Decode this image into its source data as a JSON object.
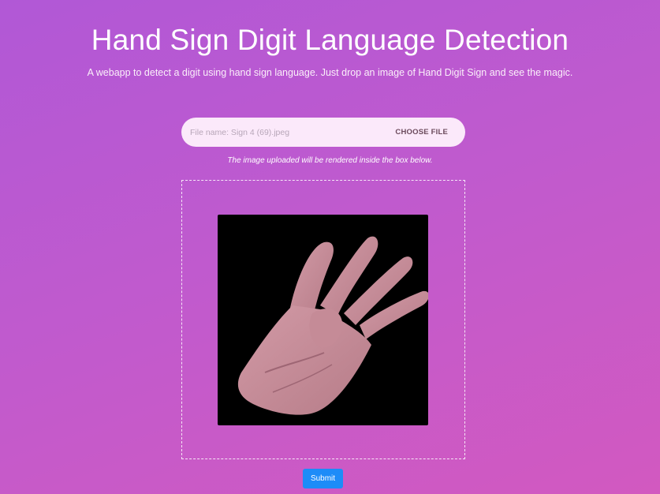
{
  "header": {
    "title": "Hand Sign Digit Language Detection",
    "subtitle": "A webapp to detect a digit using hand sign language. Just drop an image of Hand Digit Sign and see the magic."
  },
  "upload": {
    "file_name": "File name: Sign 4 (69).jpeg",
    "choose_label": "CHOOSE FILE",
    "hint": "The image uploaded will be rendered inside the box below."
  },
  "preview": {
    "icon": "hand-sign-image"
  },
  "actions": {
    "submit_label": "Submit"
  },
  "colors": {
    "background_start": "#b158d6",
    "background_end": "#d259c0",
    "file_bar": "#fbe9fa",
    "submit": "#1d8cf8"
  }
}
